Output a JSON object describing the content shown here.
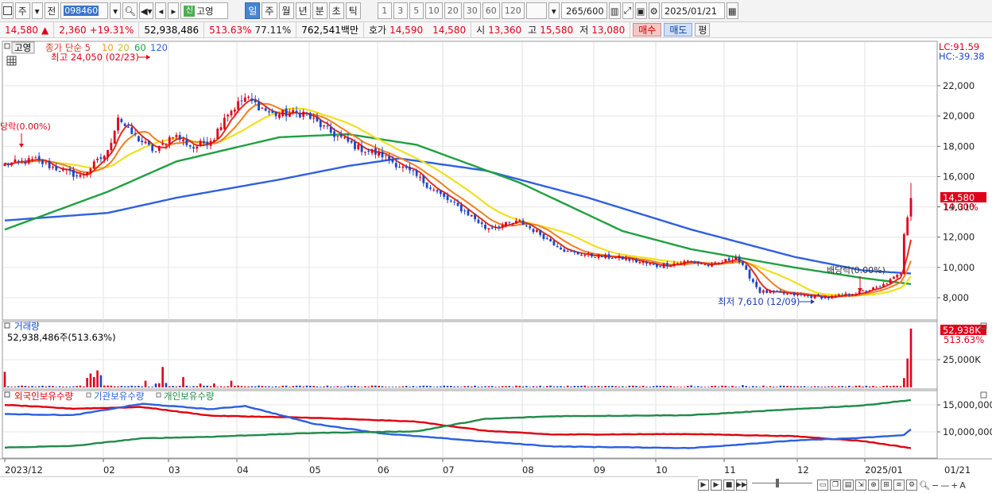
{
  "toolbar": {
    "market_type": "주",
    "front_label": "전",
    "stock_code": "098460",
    "new_mark": "신",
    "stock_name": "고영",
    "periods": [
      "일",
      "주",
      "월",
      "년",
      "분",
      "초",
      "틱"
    ],
    "active_period": "일",
    "numbers": [
      "1",
      "3",
      "5",
      "10",
      "20",
      "30",
      "60",
      "120"
    ],
    "count_display": "265/600",
    "date": "2025/01/21"
  },
  "price_bar": {
    "price": "14,580",
    "change": "2,360",
    "change_pct": "+19.31%",
    "volume": "52,938,486",
    "volume_pct": "513.63%",
    "turnover": "77.11%",
    "trade_value": "762,541백만",
    "quote_label": "호가",
    "ask": "14,590",
    "bid": "14,580",
    "open_label": "시",
    "open": "13,360",
    "high_label": "고",
    "high": "15,580",
    "low_label": "저",
    "low": "13,080",
    "buy_label": "매수",
    "sell_label": "매도",
    "even_label": "평"
  },
  "colors": {
    "up": "#e0001b",
    "down": "#1c47c6",
    "ma5": "#e03020",
    "ma10": "#f08020",
    "ma20": "#f0e020",
    "ma60": "#20a040",
    "ma120": "#3060e0"
  },
  "icons": [
    "chart-type-icon",
    "dropdown-icon",
    "search-icon",
    "speaker-icon",
    "draw-tools-icon",
    "save-icon",
    "settings-icon",
    "calendar-icon"
  ],
  "chart_data": [
    {
      "type": "candlestick",
      "title": "고영",
      "legend": [
        "종가 단순 5",
        "10",
        "20",
        "60",
        "120"
      ],
      "ylim": [
        6500,
        24500
      ],
      "y_ticks": [
        "8,000",
        "10,000",
        "12,000",
        "14,000",
        "16,000",
        "18,000",
        "20,000",
        "22,000"
      ],
      "x_ticks": [
        "2023/12",
        "02",
        "03",
        "04",
        "05",
        "06",
        "07",
        "08",
        "09",
        "10",
        "11",
        "12",
        "2025/01",
        "01/21"
      ],
      "lc_label": "LC:91.59",
      "hc_label": "HC:-39.38",
      "last_price_tag": "14,580",
      "last_pct_tag": "19.31%",
      "annotations": {
        "max": "최고 24,050 (02/23)",
        "min": "최저 7,610 (12/09)",
        "ex_div_left": "당락(0.00%)",
        "ex_div_right": "배당락(0.00%)"
      },
      "candles": {
        "count": 265,
        "close_anchors": [
          [
            0,
            16800
          ],
          [
            9,
            17100
          ],
          [
            13,
            16700
          ],
          [
            22,
            16000
          ],
          [
            30,
            17600
          ],
          [
            33,
            20000
          ],
          [
            36,
            19000
          ],
          [
            44,
            17600
          ],
          [
            49,
            18800
          ],
          [
            55,
            17900
          ],
          [
            61,
            18600
          ],
          [
            64,
            20000
          ],
          [
            70,
            21200
          ],
          [
            78,
            20100
          ],
          [
            87,
            20200
          ],
          [
            95,
            18900
          ],
          [
            103,
            17900
          ],
          [
            110,
            17400
          ],
          [
            120,
            16000
          ],
          [
            128,
            14600
          ],
          [
            136,
            13400
          ],
          [
            140,
            12600
          ],
          [
            150,
            13000
          ],
          [
            156,
            12200
          ],
          [
            164,
            11000
          ],
          [
            170,
            10800
          ],
          [
            180,
            10600
          ],
          [
            190,
            10100
          ],
          [
            199,
            10400
          ],
          [
            206,
            10100
          ],
          [
            213,
            10700
          ],
          [
            220,
            8400
          ],
          [
            230,
            8200
          ],
          [
            240,
            8000
          ],
          [
            248,
            8300
          ],
          [
            255,
            8700
          ],
          [
            261,
            9600
          ],
          [
            262,
            12200
          ],
          [
            263,
            13300
          ],
          [
            264,
            14580
          ]
        ],
        "last_candle": {
          "open": 13360,
          "high": 15580,
          "low": 13080,
          "close": 14580
        }
      },
      "moving_averages": {
        "ma60_anchors": [
          [
            0,
            12500
          ],
          [
            30,
            15000
          ],
          [
            50,
            17000
          ],
          [
            80,
            18600
          ],
          [
            100,
            18800
          ],
          [
            120,
            18100
          ],
          [
            150,
            15600
          ],
          [
            180,
            12400
          ],
          [
            200,
            11200
          ],
          [
            230,
            10000
          ],
          [
            250,
            9300
          ],
          [
            264,
            8900
          ]
        ],
        "ma120_anchors": [
          [
            0,
            13100
          ],
          [
            30,
            13600
          ],
          [
            50,
            14600
          ],
          [
            80,
            15800
          ],
          [
            100,
            16700
          ],
          [
            115,
            17200
          ],
          [
            140,
            16400
          ],
          [
            170,
            14600
          ],
          [
            200,
            12500
          ],
          [
            230,
            10700
          ],
          [
            250,
            9800
          ],
          [
            264,
            9600
          ]
        ]
      }
    },
    {
      "type": "bar",
      "title": "거래량",
      "value_label": "52,938,486주(513.63%)",
      "y_ticks": [
        "25,000K"
      ],
      "last_tag": "52,938K",
      "last_pct_tag": "513.63%",
      "ylim": [
        0,
        55000
      ],
      "last_volume_k": 52938,
      "spikes": [
        [
          0,
          14000
        ],
        [
          24,
          8500
        ],
        [
          25,
          12500
        ],
        [
          26,
          9400
        ],
        [
          27,
          15300
        ],
        [
          28,
          11000
        ],
        [
          41,
          6000
        ],
        [
          44,
          3500
        ],
        [
          45,
          3800
        ],
        [
          46,
          18400
        ],
        [
          47,
          4000
        ],
        [
          52,
          9300
        ],
        [
          57,
          3400
        ],
        [
          61,
          3500
        ],
        [
          66,
          6000
        ],
        [
          200,
          1800
        ],
        [
          215,
          2100
        ],
        [
          262,
          8400
        ],
        [
          263,
          26000
        ],
        [
          264,
          52938
        ]
      ]
    },
    {
      "type": "line",
      "title": "외국인보유수량 / 기관보유수량 / 개인보유수량",
      "series_names": [
        "외국인보유수량",
        "기관보유수량",
        "개인보유수량"
      ],
      "y_ticks": [
        "10,000,000",
        "15,000,000"
      ],
      "ylim": [
        6500000,
        16500000
      ],
      "series": [
        {
          "name": "외국인보유수량",
          "color": "#e0000e",
          "anchors": [
            [
              0,
              15000000
            ],
            [
              20,
              14300000
            ],
            [
              40,
              14600000
            ],
            [
              60,
              13000000
            ],
            [
              90,
              12600000
            ],
            [
              120,
              11900000
            ],
            [
              140,
              10200000
            ],
            [
              160,
              9500000
            ],
            [
              200,
              9600000
            ],
            [
              230,
              9200000
            ],
            [
              250,
              8300000
            ],
            [
              264,
              7000000
            ]
          ]
        },
        {
          "name": "기관보유수량",
          "color": "#2b5fe0",
          "anchors": [
            [
              0,
              13300000
            ],
            [
              20,
              13100000
            ],
            [
              40,
              15200000
            ],
            [
              50,
              14700000
            ],
            [
              60,
              14200000
            ],
            [
              70,
              14800000
            ],
            [
              90,
              11500000
            ],
            [
              110,
              9700000
            ],
            [
              140,
              8200000
            ],
            [
              160,
              7300000
            ],
            [
              200,
              7000000
            ],
            [
              230,
              8400000
            ],
            [
              250,
              8900000
            ],
            [
              262,
              9400000
            ],
            [
              264,
              10500000
            ]
          ]
        },
        {
          "name": "개인보유수량",
          "color": "#228a4a",
          "anchors": [
            [
              0,
              7100000
            ],
            [
              20,
              7400000
            ],
            [
              40,
              8800000
            ],
            [
              60,
              9100000
            ],
            [
              90,
              9800000
            ],
            [
              120,
              10100000
            ],
            [
              140,
              12400000
            ],
            [
              160,
              12900000
            ],
            [
              200,
              13100000
            ],
            [
              230,
              14200000
            ],
            [
              250,
              14900000
            ],
            [
              264,
              15900000
            ]
          ]
        }
      ]
    }
  ]
}
